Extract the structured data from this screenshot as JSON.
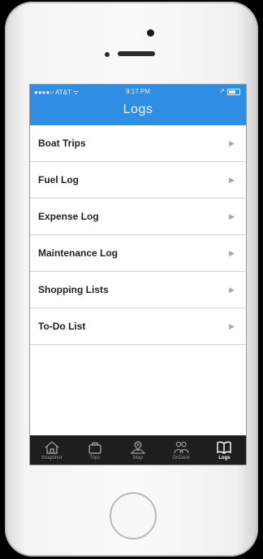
{
  "status_bar": {
    "carrier": "●●●●○ AT&T ᯤ",
    "time": "9:17 PM"
  },
  "header": {
    "title": "Logs"
  },
  "colors": {
    "header": "#2d8ee3",
    "tabbar": "#1e1e1e"
  },
  "logs": [
    {
      "label": "Boat Trips"
    },
    {
      "label": "Fuel Log"
    },
    {
      "label": "Expense Log"
    },
    {
      "label": "Maintenance Log"
    },
    {
      "label": "Shopping Lists"
    },
    {
      "label": "To-Do List"
    }
  ],
  "tabbar": {
    "tabs": [
      {
        "label": "Snapshot",
        "icon": "home-icon"
      },
      {
        "label": "Trips",
        "icon": "briefcase-icon"
      },
      {
        "label": "Map",
        "icon": "map-pin-icon"
      },
      {
        "label": "OnDeck",
        "icon": "people-icon"
      },
      {
        "label": "Logs",
        "icon": "book-icon",
        "active": true
      }
    ]
  }
}
